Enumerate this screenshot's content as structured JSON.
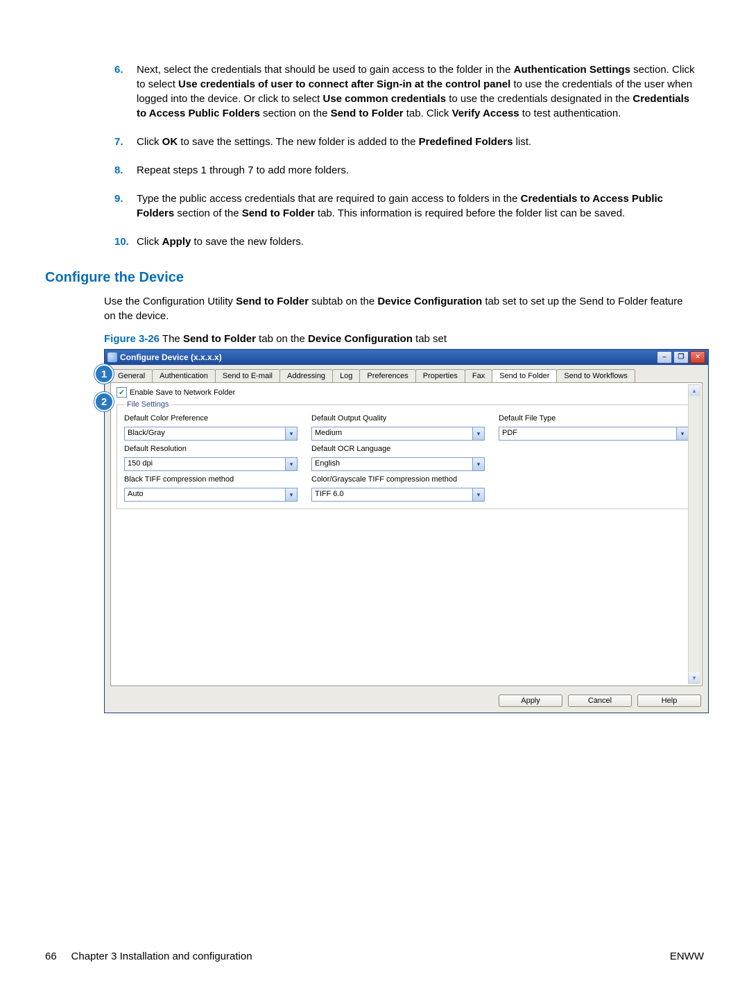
{
  "steps": {
    "s6": {
      "num": "6.",
      "t1": "Next, select the credentials that should be used to gain access to the folder in the ",
      "b1": "Authentication Settings",
      "t2": " section. Click to select ",
      "b2": "Use credentials of user to connect after Sign-in at the control panel",
      "t3": " to use the credentials of the user when logged into the device. Or click to select ",
      "b3": "Use common credentials",
      "t4": " to use the credentials designated in the ",
      "b4": "Credentials to Access Public Folders",
      "t5": " section on the ",
      "b5": "Send to Folder",
      "t6": " tab. Click ",
      "b6": "Verify Access",
      "t7": " to test authentication."
    },
    "s7": {
      "num": "7.",
      "t1": "Click ",
      "b1": "OK",
      "t2": " to save the settings. The new folder is added to the ",
      "b2": "Predefined Folders",
      "t3": " list."
    },
    "s8": {
      "num": "8.",
      "t1": "Repeat steps 1 through 7 to add more folders."
    },
    "s9": {
      "num": "9.",
      "t1": "Type the public access credentials that are required to gain access to folders in the ",
      "b1": "Credentials to Access Public Folders",
      "t2": " section of the ",
      "b2": "Send to Folder",
      "t3": " tab. This information is required before the folder list can be saved."
    },
    "s10": {
      "num": "10.",
      "t1": "Click ",
      "b1": "Apply",
      "t2": " to save the new folders."
    }
  },
  "section_heading": "Configure the Device",
  "intro": {
    "t1": "Use the Configuration Utility ",
    "b1": "Send to Folder",
    "t2": " subtab on the ",
    "b2": "Device Configuration",
    "t3": " tab set to set up the Send to Folder feature on the device."
  },
  "figure": {
    "label": "Figure 3-26",
    "t1": "  The ",
    "b1": "Send to Folder",
    "t2": " tab on the ",
    "b2": "Device Configuration",
    "t3": " tab set"
  },
  "callouts": {
    "c1": "1",
    "c2": "2"
  },
  "window": {
    "title": "Configure Device (x.x.x.x)",
    "tabs": [
      "General",
      "Authentication",
      "Send to E-mail",
      "Addressing",
      "Log",
      "Preferences",
      "Properties",
      "Fax",
      "Send to Folder",
      "Send to Workflows"
    ],
    "active_tab_index": 8,
    "enable_checkbox": "Enable Save to Network Folder",
    "fieldset_legend": "File Settings",
    "labels": {
      "color": "Default Color Preference",
      "quality": "Default Output Quality",
      "filetype": "Default File Type",
      "resolution": "Default Resolution",
      "ocr": "Default OCR Language",
      "btiff": "Black TIFF compression method",
      "ctiff": "Color/Grayscale TIFF compression method"
    },
    "values": {
      "color": "Black/Gray",
      "quality": "Medium",
      "filetype": "PDF",
      "resolution": "150 dpi",
      "ocr": "English",
      "btiff": "Auto",
      "ctiff": "TIFF 6.0"
    },
    "buttons": {
      "apply": "Apply",
      "cancel": "Cancel",
      "help": "Help"
    }
  },
  "footer": {
    "page": "66",
    "chapter": "Chapter 3   Installation and configuration",
    "right": "ENWW"
  }
}
